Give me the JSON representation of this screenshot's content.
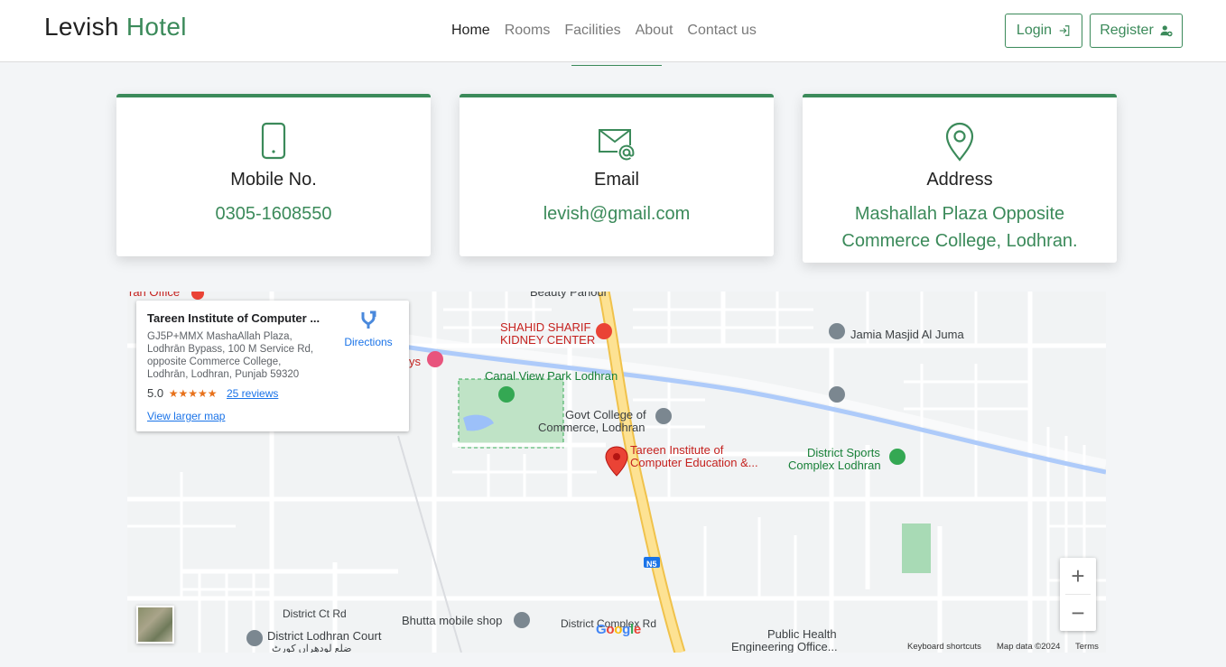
{
  "brand": {
    "name": "Levish",
    "accent": "Hotel"
  },
  "nav": {
    "items": [
      {
        "label": "Home",
        "active": true
      },
      {
        "label": "Rooms",
        "active": false
      },
      {
        "label": "Facilities",
        "active": false
      },
      {
        "label": "About",
        "active": false
      },
      {
        "label": "Contact us",
        "active": false
      }
    ],
    "login_label": "Login",
    "register_label": "Register"
  },
  "contact": {
    "mobile": {
      "title": "Mobile No.",
      "value": "0305-1608550",
      "icon": "phone-icon"
    },
    "email": {
      "title": "Email",
      "value": "levish@gmail.com",
      "icon": "envelope-at-icon"
    },
    "address": {
      "title": "Address",
      "value": "Mashallah Plaza Opposite Commerce College, Lodhran.",
      "icon": "location-pin-icon"
    }
  },
  "map": {
    "place_name": "Tareen Institute of Computer ...",
    "address_line1": "GJ5P+MMX MashaAllah Plaza,",
    "address_line2": "Lodhrān Bypass, 100 M Service Rd,",
    "address_line3": "opposite Commerce College,",
    "address_line4": "Lodhrān, Lodhran, Punjab 59320",
    "rating": "5.0",
    "stars": "★★★★★",
    "reviews": "25 reviews",
    "view_larger": "View larger map",
    "directions": "Directions",
    "labels": {
      "iran_office": "ran Office",
      "beauty_parlour": "Beauty Parlour",
      "shahid_line1": "SHAHID SHARIF",
      "shahid_line2": "KIDNEY CENTER",
      "jamia": "Jamia Masjid Al Juma",
      "ys": "ys",
      "canal_park": "Canal View Park Lodhran",
      "govt_line1": "Govt College of",
      "govt_line2": "Commerce, Lodhran",
      "tareen_line1": "Tareen Institute of",
      "tareen_line2": "Computer Education &...",
      "sports_line1": "District Sports",
      "sports_line2": "Complex Lodhran",
      "n5": "N5",
      "ct_rd": "District Ct Rd",
      "bhutta": "Bhutta mobile shop",
      "complex_rd": "District Complex Rd",
      "court": "District Lodhran Court",
      "court_urdu": "ضلع لودھراں کورٹ",
      "public_line1": "Public Health",
      "public_line2": "Engineering Office..."
    },
    "footer": {
      "shortcuts": "Keyboard shortcuts",
      "map_data": "Map data ©2024",
      "terms": "Terms"
    },
    "zoom_in": "+",
    "zoom_out": "−"
  }
}
